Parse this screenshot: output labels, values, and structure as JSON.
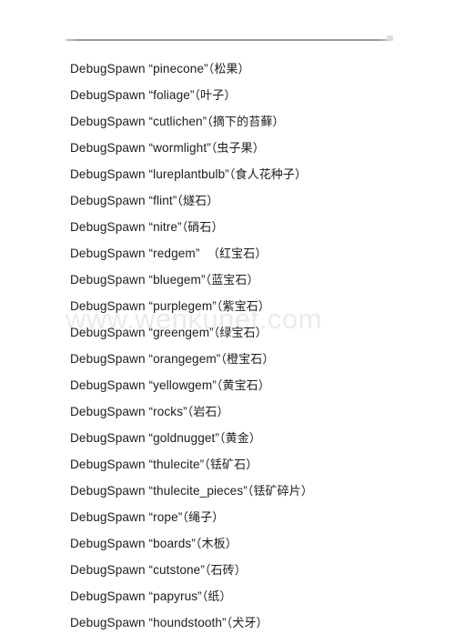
{
  "document": {
    "watermark": "www.wenkunet.com",
    "footer_mark": "·",
    "header_rule_label": "",
    "lines": [
      {
        "command": "DebugSpawn “pinecone”",
        "gloss": "（松果）"
      },
      {
        "command": "DebugSpawn “foliage”",
        "gloss": "（叶子）"
      },
      {
        "command": "DebugSpawn “cutlichen”",
        "gloss": "（摘下的苔藓）"
      },
      {
        "command": "DebugSpawn “wormlight”",
        "gloss": "（虫子果）"
      },
      {
        "command": "DebugSpawn “lureplantbulb”",
        "gloss": "（食人花种子）"
      },
      {
        "command": "DebugSpawn “flint”",
        "gloss": "（燧石）"
      },
      {
        "command": "DebugSpawn “nitre”",
        "gloss": "（硝石）"
      },
      {
        "command": "DebugSpawn “redgem”",
        "gloss": "  （红宝石）"
      },
      {
        "command": "DebugSpawn “bluegem”",
        "gloss": "（蓝宝石）"
      },
      {
        "command": "DebugSpawn “purplegem”",
        "gloss": "（紫宝石）"
      },
      {
        "command": "DebugSpawn “greengem”",
        "gloss": "（绿宝石）"
      },
      {
        "command": "DebugSpawn “orangegem”",
        "gloss": "（橙宝石）"
      },
      {
        "command": "DebugSpawn “yellowgem”",
        "gloss": "（黄宝石）"
      },
      {
        "command": "DebugSpawn “rocks”",
        "gloss": "（岩石）"
      },
      {
        "command": "DebugSpawn “goldnugget”",
        "gloss": "（黄金）"
      },
      {
        "command": "DebugSpawn “thulecite”",
        "gloss": "（铥矿石）"
      },
      {
        "command": "DebugSpawn “thulecite_pieces”",
        "gloss": "（铥矿碎片）"
      },
      {
        "command": "DebugSpawn “rope”",
        "gloss": "（绳子）"
      },
      {
        "command": "DebugSpawn “boards”",
        "gloss": "（木板）"
      },
      {
        "command": "DebugSpawn “cutstone”",
        "gloss": "（石砖）"
      },
      {
        "command": "DebugSpawn “papyrus”",
        "gloss": "（纸）"
      },
      {
        "command": "DebugSpawn “houndstooth”",
        "gloss": "（犬牙）"
      }
    ]
  }
}
